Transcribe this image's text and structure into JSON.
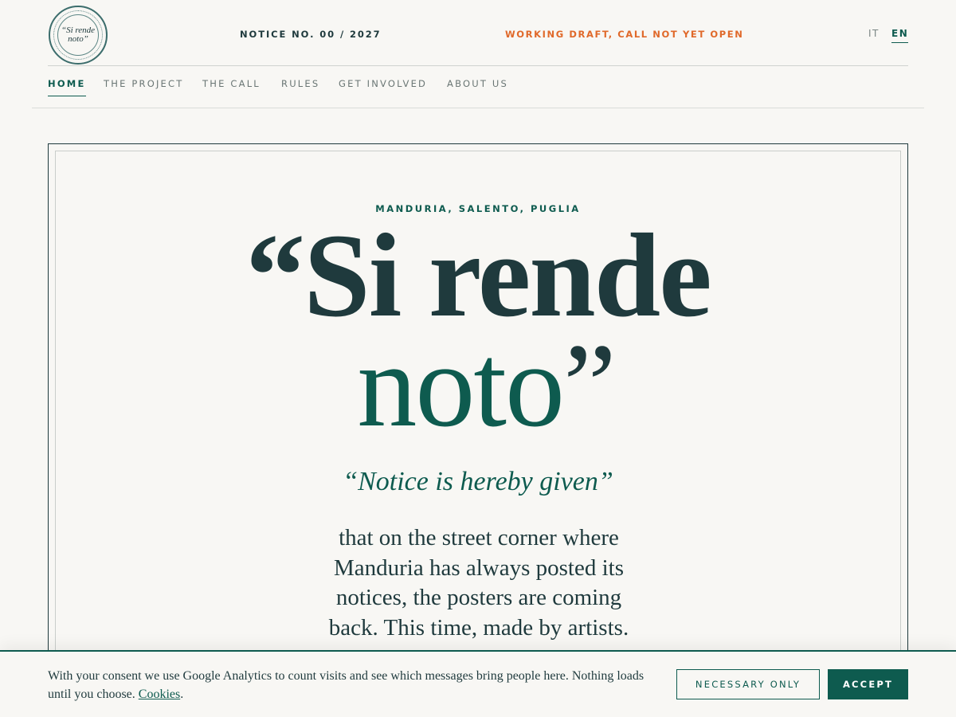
{
  "header": {
    "stamp_text": "“Si rende noto”",
    "notice_number": "NOTICE NO. 00 / 2027",
    "status": "WORKING DRAFT, CALL NOT YET OPEN",
    "languages": [
      "IT",
      "EN"
    ],
    "active_language": "EN"
  },
  "nav": {
    "items": [
      "HOME",
      "THE PROJECT",
      "THE CALL",
      "RULES",
      "GET INVOLVED",
      "ABOUT US"
    ],
    "active": "HOME"
  },
  "hero": {
    "place": "MANDURIA, SALENTO, PUGLIA",
    "headline_line1": "“Si rende",
    "headline_line2_word": "noto",
    "headline_line2_quote": "”",
    "subtitle": "“Notice is hereby given”",
    "intro": "that on the street corner where Manduria has always posted its notices, the posters are coming back. This time, made by artists."
  },
  "cookie": {
    "text": "With your consent we use Google Analytics to count visits and see which messages bring people here. Nothing loads until you choose.",
    "link_label": "Cookies",
    "after_link": ".",
    "necessary_label": "NECESSARY ONLY",
    "accept_label": "ACCEPT"
  },
  "colors": {
    "background": "#f8f7f4",
    "ink": "#1f3a3d",
    "accent_green": "#0e5b4f",
    "accent_orange": "#e0692a"
  }
}
